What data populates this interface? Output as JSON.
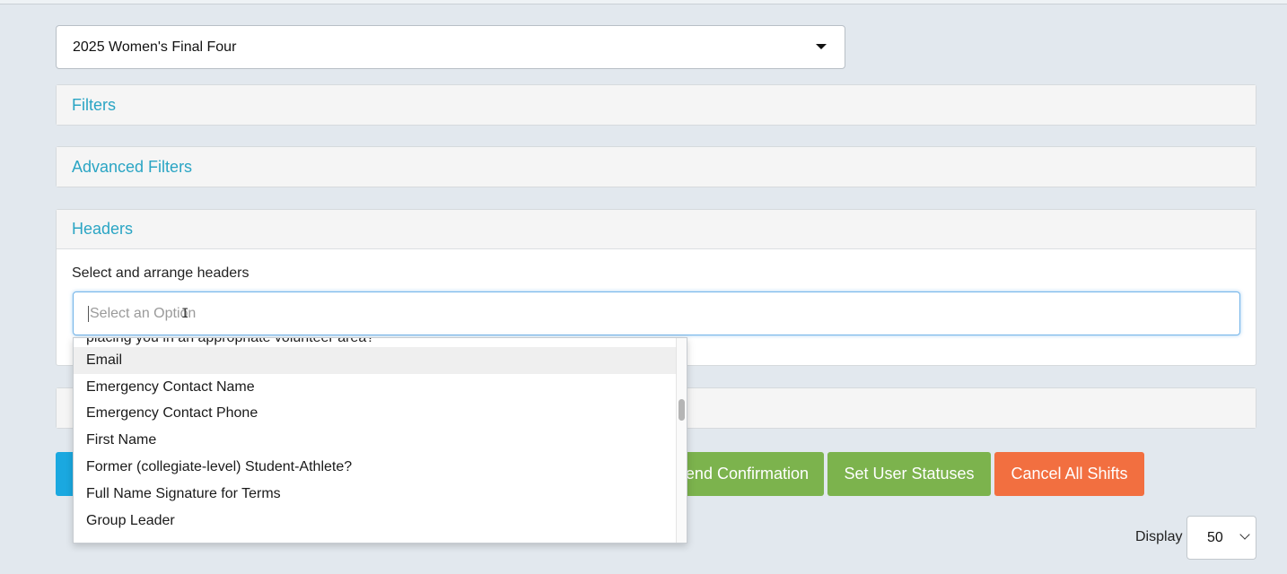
{
  "event_select": {
    "value": "2025 Women's Final Four"
  },
  "panels": {
    "filters": {
      "title": "Filters"
    },
    "advanced_filters": {
      "title": "Advanced Filters"
    },
    "headers": {
      "title": "Headers",
      "label": "Select and arrange headers",
      "placeholder": "Select an Option"
    }
  },
  "dropdown": {
    "items": [
      "placing you in an appropriate volunteer area?",
      "Email",
      "Emergency Contact Name",
      "Emergency Contact Phone",
      "First Name",
      "Former (collegiate-level) Student-Athlete?",
      "Full Name Signature for Terms",
      "Group Leader"
    ],
    "highlighted": "Email"
  },
  "buttons": {
    "send_confirmation": "end Confirmation",
    "set_user_statuses": "Set User Statuses",
    "cancel_all_shifts": "Cancel All Shifts"
  },
  "display": {
    "label": "Display",
    "value": "50"
  },
  "colors": {
    "accent_link": "#2aa5c4",
    "btn_blue": "#1aa8e0",
    "btn_green": "#7cb34d",
    "btn_orange": "#f26f40"
  }
}
